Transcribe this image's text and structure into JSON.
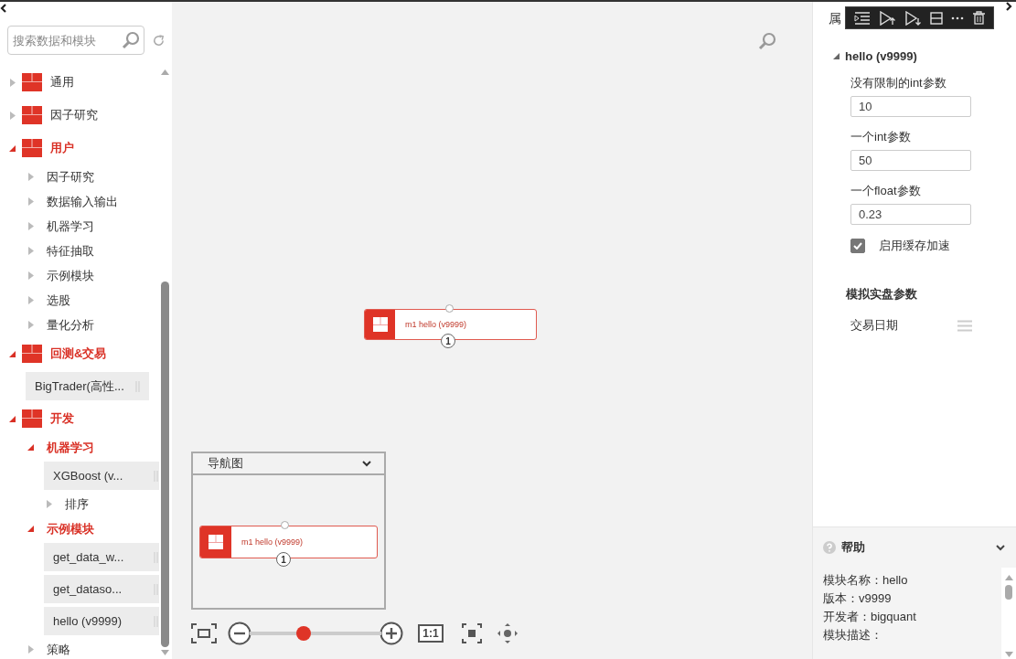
{
  "sidebar": {
    "search": {
      "placeholder": "搜索数据和模块"
    },
    "tree": [
      {
        "label": "通用",
        "kind": "category",
        "expanded": false
      },
      {
        "label": "因子研究",
        "kind": "category",
        "expanded": false
      },
      {
        "label": "用户",
        "kind": "category",
        "expanded": true,
        "children": [
          {
            "label": "因子研究",
            "kind": "folder",
            "expanded": false
          },
          {
            "label": "数据输入输出",
            "kind": "folder",
            "expanded": false
          },
          {
            "label": "机器学习",
            "kind": "folder",
            "expanded": false
          },
          {
            "label": "特征抽取",
            "kind": "folder",
            "expanded": false
          },
          {
            "label": "示例模块",
            "kind": "folder",
            "expanded": false
          },
          {
            "label": "选股",
            "kind": "folder",
            "expanded": false
          },
          {
            "label": "量化分析",
            "kind": "folder",
            "expanded": false
          }
        ]
      },
      {
        "label": "回测&交易",
        "kind": "category",
        "expanded": true,
        "children": [
          {
            "label": "BigTrader(高性...",
            "kind": "module"
          }
        ]
      },
      {
        "label": "开发",
        "kind": "category",
        "expanded": true,
        "children": [
          {
            "label": "机器学习",
            "kind": "folder",
            "expanded": true,
            "children": [
              {
                "label": "XGBoost (v...",
                "kind": "module"
              },
              {
                "label": "排序",
                "kind": "folder",
                "expanded": false
              }
            ]
          },
          {
            "label": "示例模块",
            "kind": "folder",
            "expanded": true,
            "children": [
              {
                "label": "get_data_w...",
                "kind": "module"
              },
              {
                "label": "get_dataso...",
                "kind": "module"
              },
              {
                "label": "hello (v9999)",
                "kind": "module"
              }
            ]
          },
          {
            "label": "策略",
            "kind": "folder",
            "expanded": false
          }
        ]
      }
    ]
  },
  "canvas": {
    "nodes": [
      {
        "label": "m1 hello (v9999)",
        "port": "1"
      }
    ],
    "navigator": {
      "title": "导航图",
      "nodes": [
        {
          "label": "m1 hello (v9999)",
          "port": "1"
        }
      ]
    },
    "zoom": {
      "level": 0.41,
      "reset_label": "1:1"
    }
  },
  "properties": {
    "title": "属",
    "module": {
      "title": "hello (v9999)",
      "expanded": true,
      "params": [
        {
          "kind": "input",
          "label": "没有限制的int参数",
          "value": "10"
        },
        {
          "kind": "input",
          "label": "一个int参数",
          "value": "50"
        },
        {
          "kind": "input",
          "label": "一个float参数",
          "value": "0.23"
        },
        {
          "kind": "checkbox",
          "label": "启用缓存加速",
          "checked": true
        }
      ]
    },
    "live": {
      "title": "模拟实盘参数",
      "params": [
        {
          "label": "交易日期"
        }
      ]
    }
  },
  "help": {
    "title": "帮助",
    "lines": [
      "模块名称：hello",
      "版本：v9999",
      "开发者：bigquant",
      "模块描述："
    ]
  }
}
